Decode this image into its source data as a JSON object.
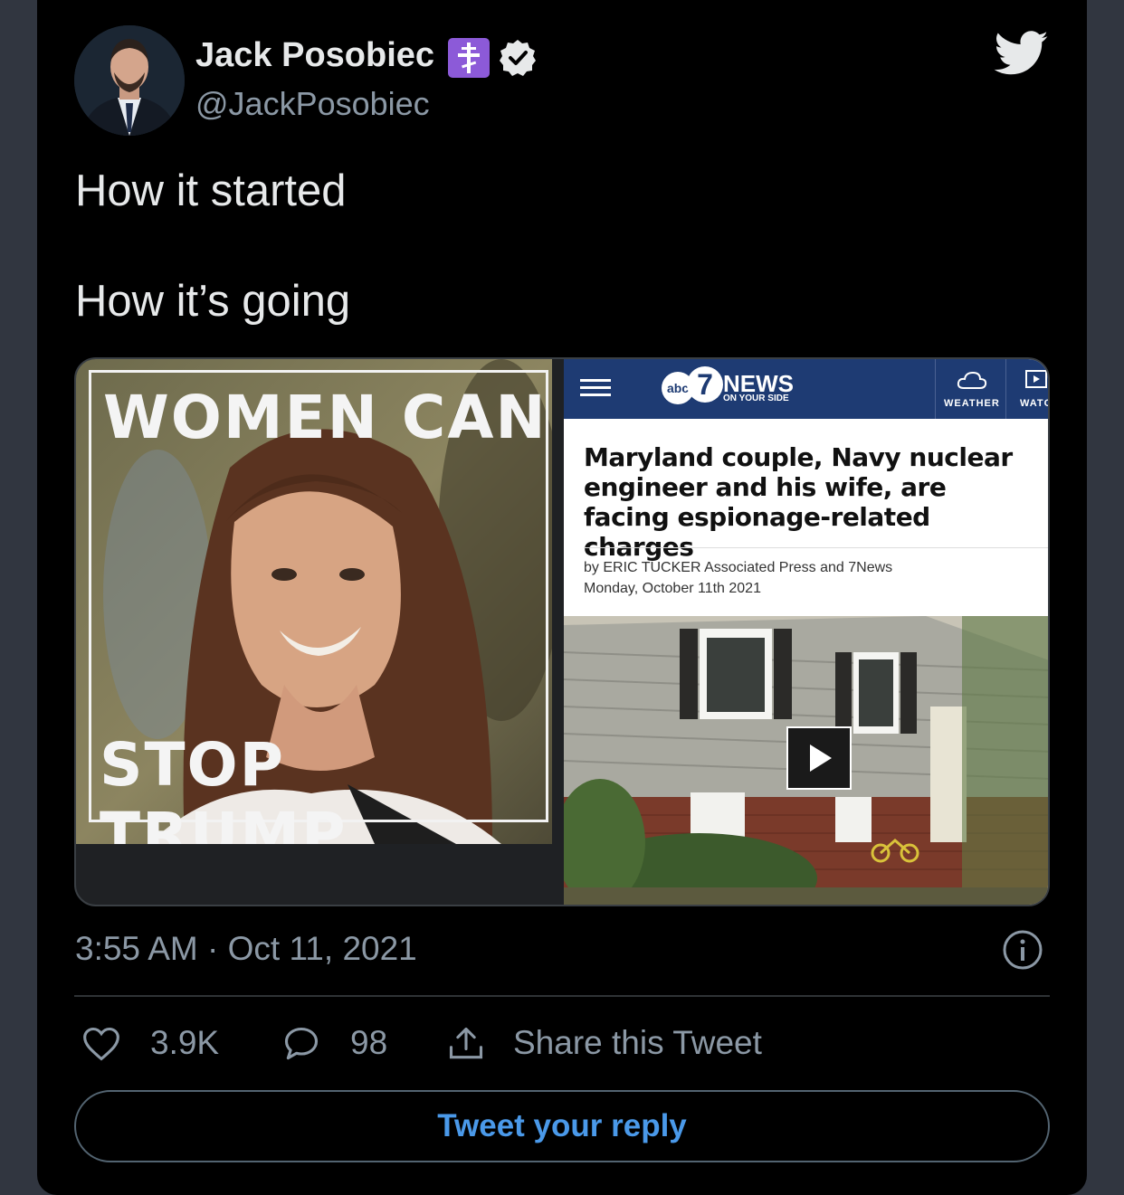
{
  "tweet": {
    "author_name": "Jack Posobiec",
    "handle": "@JackPosobiec",
    "text_line1": "How it started",
    "text_line2": "How it’s going",
    "timestamp": "3:55 AM · Oct 11, 2021",
    "likes": "3.9K",
    "replies": "98",
    "share_label": "Share this Tweet",
    "reply_button": "Tweet your reply"
  },
  "media": {
    "left_image": {
      "top_text": "WOMEN CAN",
      "bottom_text": "STOP TRUMP"
    },
    "right_image": {
      "logo_news": "NEWS",
      "logo_tagline": "ON YOUR SIDE",
      "logo_abc": "abc",
      "logo_7": "7",
      "nav_weather": "WEATHER",
      "nav_watch": "WATC",
      "headline": "Maryland couple, Navy nuclear engineer and his wife, are facing espionage-related charges",
      "byline_author": "by ERIC TUCKER Associated Press and 7News",
      "byline_date": "Monday, October 11th 2021"
    }
  },
  "colors": {
    "background": "#000000",
    "outer": "#313640",
    "text_primary": "#e7e9ea",
    "text_secondary": "#8b98a5",
    "accent": "#4a99e9",
    "badge_purple": "#8c5ad8",
    "abc_blue": "#1e3b73"
  },
  "icons": [
    "twitter-bird-icon",
    "verified-badge-icon",
    "orthodox-cross-icon",
    "info-icon",
    "heart-icon",
    "reply-bubble-icon",
    "share-icon",
    "play-icon",
    "hamburger-icon",
    "cloud-icon",
    "watch-icon"
  ]
}
